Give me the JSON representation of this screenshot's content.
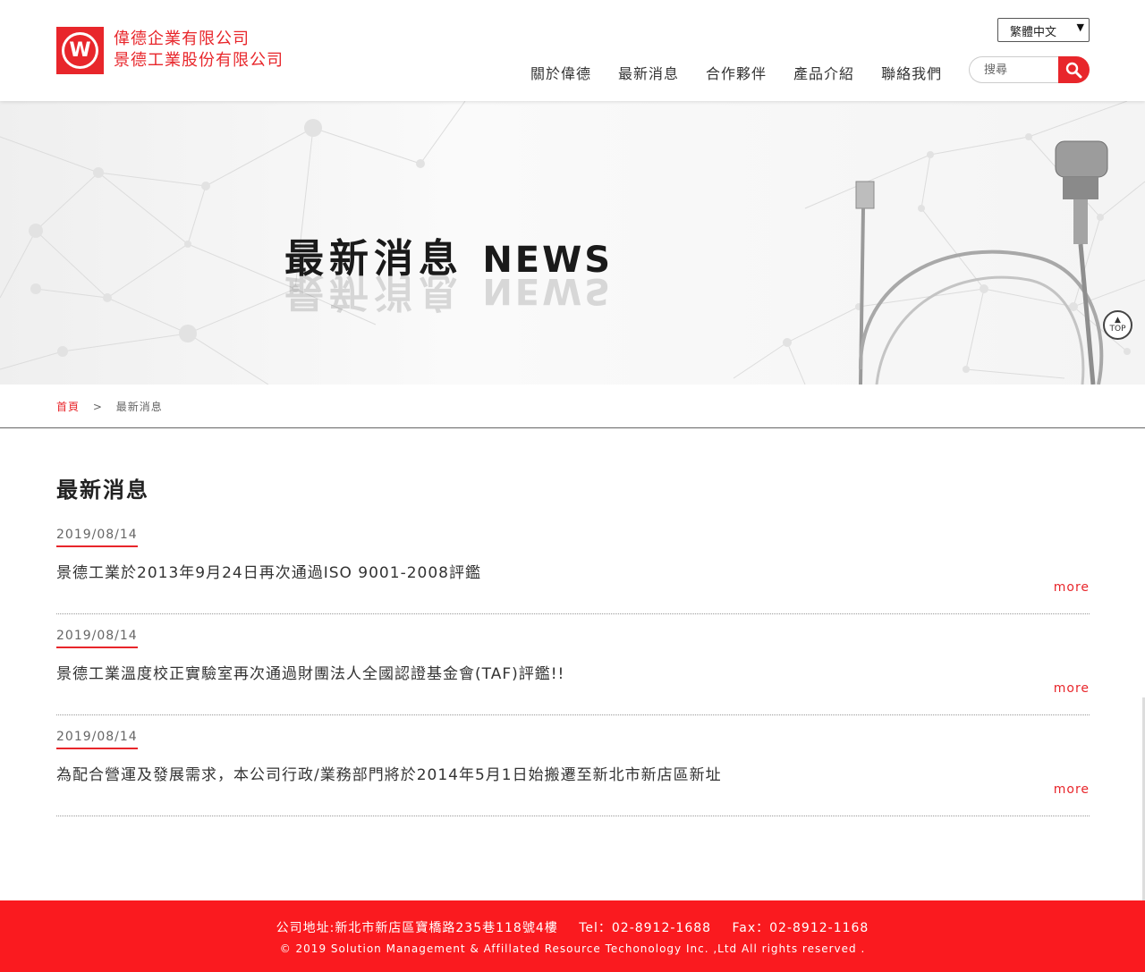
{
  "header": {
    "company_line1": "偉德企業有限公司",
    "company_line2": "景德工業股份有限公司",
    "language": "繁體中文",
    "nav": [
      "關於偉德",
      "最新消息",
      "合作夥伴",
      "產品介紹",
      "聯絡我們"
    ],
    "search_placeholder": "搜尋"
  },
  "banner": {
    "title_zh": "最新消息",
    "title_en": "NEWS",
    "top_label": "TOP"
  },
  "breadcrumb": {
    "home": "首頁",
    "separator": ">",
    "current": "最新消息"
  },
  "main": {
    "title": "最新消息",
    "news": [
      {
        "date": "2019/08/14",
        "title": "景德工業於2013年9月24日再次通過ISO 9001-2008評鑑",
        "more": "more"
      },
      {
        "date": "2019/08/14",
        "title": "景德工業溫度校正實驗室再次通過財團法人全國認證基金會(TAF)評鑑!!",
        "more": "more"
      },
      {
        "date": "2019/08/14",
        "title": "為配合營運及發展需求，本公司行政/業務部門將於2014年5月1日始搬遷至新北市新店區新址",
        "more": "more"
      }
    ]
  },
  "footer": {
    "address": "公司地址:新北市新店區寶橋路235巷118號4樓",
    "tel": "Tel：02-8912-1688",
    "fax": "Fax：02-8912-1168",
    "copyright": "© 2019 Solution Management & Affillated Resource Techonology Inc. ,Ltd All rights reserved ."
  },
  "colors": {
    "brand_red": "#e8262b",
    "footer_red": "#fa1a1f"
  }
}
